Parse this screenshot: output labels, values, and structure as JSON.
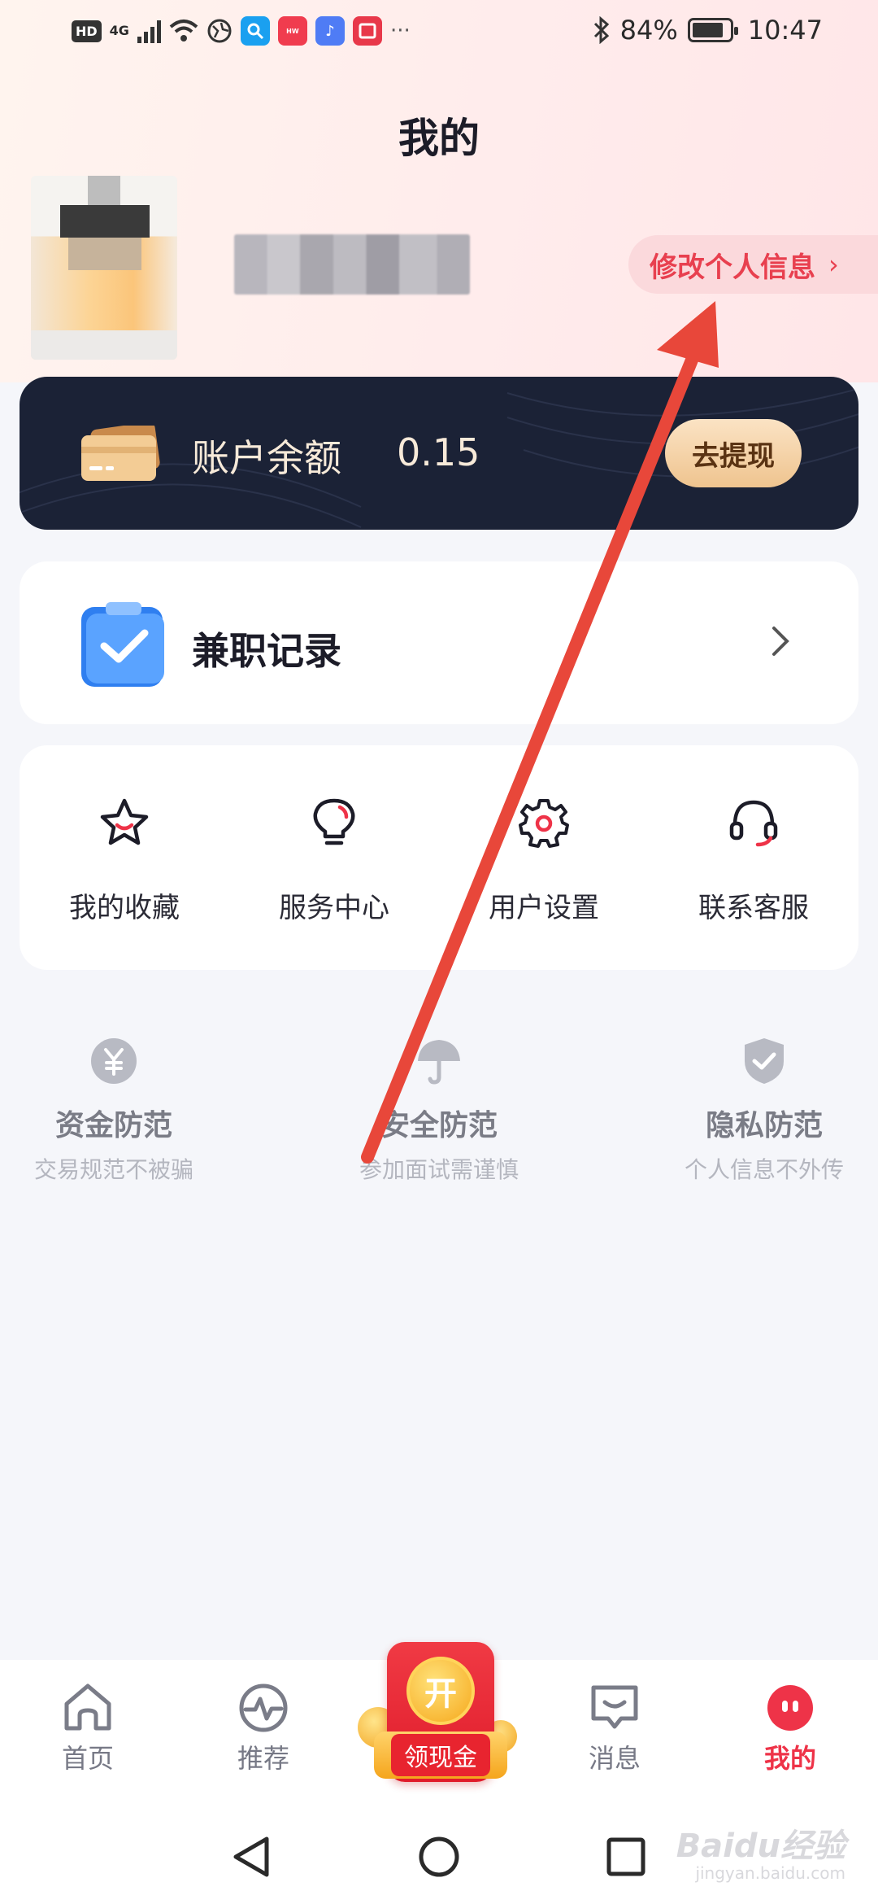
{
  "status_bar": {
    "hd": "HD",
    "network": "4G",
    "more": "···",
    "battery": "84%",
    "time": "10:47",
    "battery_level": 0.84
  },
  "header": {
    "title": "我的"
  },
  "profile": {
    "edit_label": "修改个人信息"
  },
  "balance": {
    "label": "账户余额",
    "value": "0.15",
    "withdraw_label": "去提现"
  },
  "records": {
    "label": "兼职记录"
  },
  "shortcuts": [
    {
      "label": "我的收藏",
      "icon": "star-icon"
    },
    {
      "label": "服务中心",
      "icon": "lightbulb-icon"
    },
    {
      "label": "用户设置",
      "icon": "gear-icon"
    },
    {
      "label": "联系客服",
      "icon": "headset-icon"
    }
  ],
  "tips": [
    {
      "title": "资金防范",
      "subtitle": "交易规范不被骗",
      "icon": "yuan-icon"
    },
    {
      "title": "安全防范",
      "subtitle": "参加面试需谨慎",
      "icon": "umbrella-icon"
    },
    {
      "title": "隐私防范",
      "subtitle": "个人信息不外传",
      "icon": "shield-icon"
    }
  ],
  "bottom_nav": {
    "items": [
      {
        "label": "首页",
        "icon": "home-icon"
      },
      {
        "label": "推荐",
        "icon": "pulse-icon"
      },
      {
        "label": "消息",
        "icon": "message-icon"
      },
      {
        "label": "我的",
        "icon": "profile-icon"
      }
    ],
    "promo": {
      "coin_text": "开",
      "label": "领现金"
    }
  },
  "watermark": {
    "text": "Baidu经验",
    "sub": "jingyan.baidu.com"
  },
  "colors": {
    "accent": "#ee3348",
    "card_dark": "#1b2236",
    "gold": "#f0c690"
  }
}
